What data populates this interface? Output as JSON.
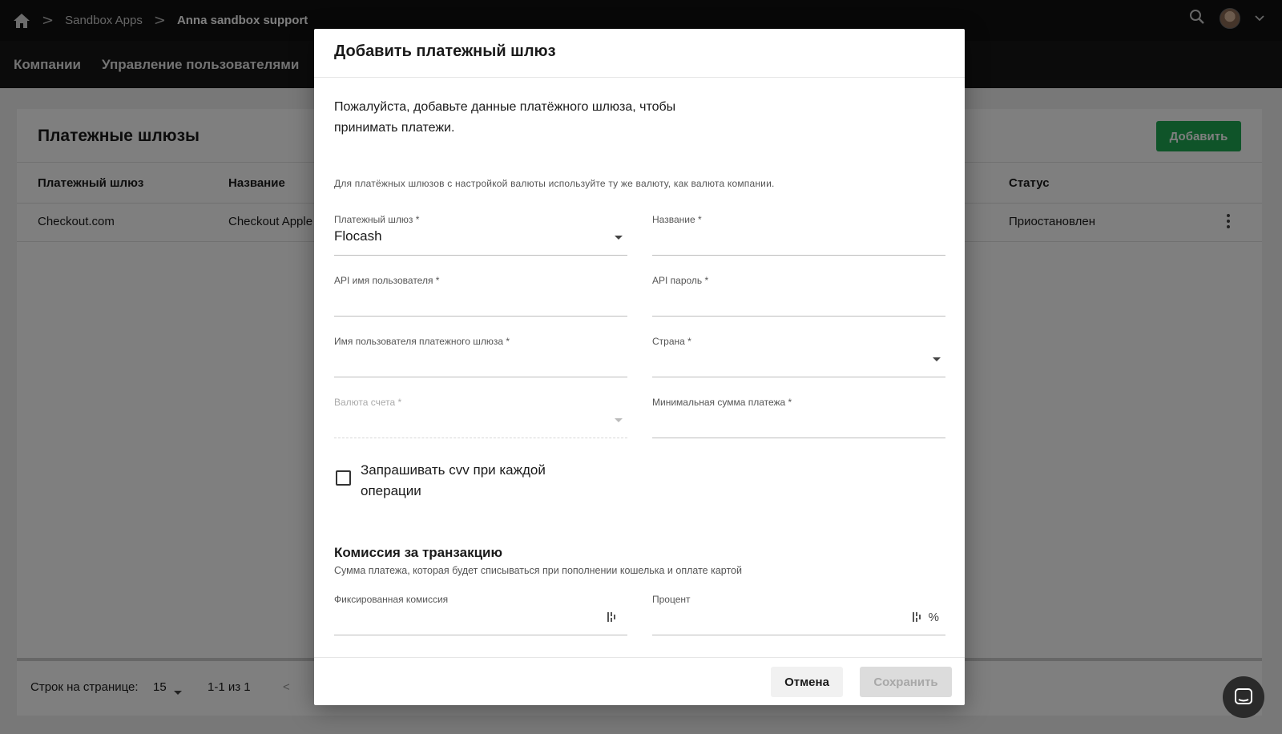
{
  "breadcrumb": {
    "items": [
      "Sandbox Apps",
      "Anna sandbox support"
    ],
    "separator": ">"
  },
  "nav": {
    "items": [
      "Компании",
      "Управление пользователями"
    ]
  },
  "page": {
    "title": "Платежные шлюзы",
    "add_button": "Добавить",
    "columns": [
      "Платежный шлюз",
      "Название",
      "Статус"
    ],
    "rows": [
      {
        "gateway": "Checkout.com",
        "name": "Checkout Apple",
        "status": "Приостановлен"
      }
    ],
    "footer": {
      "rows_per_page_label": "Строк на странице:",
      "rows_per_page_value": "15",
      "range": "1-1 из 1",
      "prev_glyph": "<"
    }
  },
  "modal": {
    "title": "Добавить платежный шлюз",
    "intro": "Пожалуйста, добавьте данные платёжного шлюза, чтобы принимать платежи.",
    "hint": "Для платёжных шлюзов с настройкой валюты используйте ту же валюту, как валюта компании.",
    "fields": {
      "gateway": {
        "label": "Платежный шлюз *",
        "value": "Flocash"
      },
      "name": {
        "label": "Название *",
        "value": ""
      },
      "api_user": {
        "label": "API имя пользователя *",
        "value": ""
      },
      "api_password": {
        "label": "API пароль *",
        "value": ""
      },
      "gateway_user": {
        "label": "Имя пользователя платежного шлюза *",
        "value": ""
      },
      "country": {
        "label": "Страна *",
        "value": ""
      },
      "currency": {
        "label": "Валюта счета *",
        "value": ""
      },
      "min_amount": {
        "label": "Минимальная сумма платежа *",
        "value": ""
      },
      "fixed_fee": {
        "label": "Фиксированная комиссия",
        "value": ""
      },
      "percent": {
        "label": "Процент",
        "value": "",
        "suffix": "%"
      }
    },
    "checkbox_cvv": {
      "label": "Запрашивать cvv при каждой операции",
      "checked": false
    },
    "fee_section": {
      "title": "Комиссия за транзакцию",
      "hint": "Сумма платежа, которая будет списываться при пополнении кошелька и оплате картой"
    },
    "buttons": {
      "cancel": "Отмена",
      "save": "Сохранить"
    }
  },
  "colors": {
    "add_button": "#1ea853",
    "topbar": "#111111",
    "save_disabled": "#dcdcdc"
  },
  "icons": [
    "home-icon",
    "search-icon",
    "avatar",
    "chevron-down-icon",
    "kebab-menu-icon",
    "chat-icon"
  ]
}
